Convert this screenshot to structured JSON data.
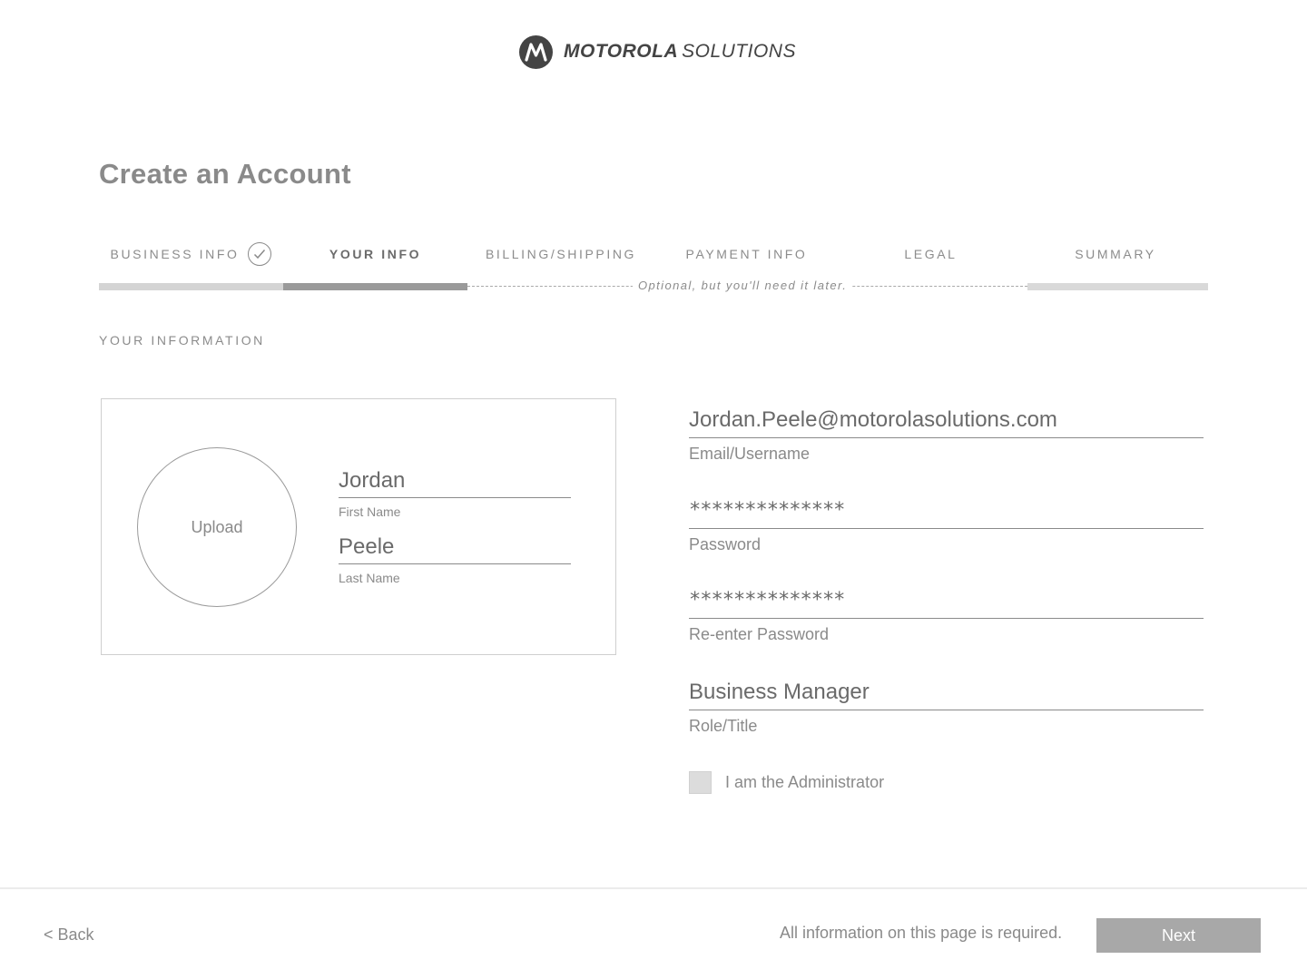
{
  "brand": {
    "name_bold": "MOTOROLA",
    "name_light": "SOLUTIONS"
  },
  "page": {
    "title": "Create an Account",
    "section_label": "YOUR INFORMATION"
  },
  "steps": [
    {
      "label": "BUSINESS INFO",
      "state": "done"
    },
    {
      "label": "YOUR INFO",
      "state": "active"
    },
    {
      "label": "BILLING/SHIPPING",
      "state": "optional"
    },
    {
      "label": "PAYMENT INFO",
      "state": "optional"
    },
    {
      "label": "LEGAL",
      "state": "optional"
    },
    {
      "label": "SUMMARY",
      "state": "pending"
    }
  ],
  "optional_note": "Optional, but you'll need it later.",
  "profile": {
    "upload_label": "Upload",
    "first_name": {
      "value": "Jordan",
      "label": "First Name"
    },
    "last_name": {
      "value": "Peele",
      "label": "Last Name"
    }
  },
  "form": {
    "email": {
      "value": "Jordan.Peele@motorolasolutions.com",
      "label": "Email/Username"
    },
    "password": {
      "value": "**************",
      "label": "Password"
    },
    "password_confirm": {
      "value": "**************",
      "label": "Re-enter Password"
    },
    "role": {
      "value": "Business Manager",
      "label": "Role/Title"
    },
    "admin_checkbox": {
      "label": "I am the Administrator",
      "checked": false
    }
  },
  "footer": {
    "back_label": "< Back",
    "required_note": "All information on this page is required.",
    "next_label": "Next"
  },
  "colors": {
    "active_bar": "#9a9a9a",
    "done_bar": "#d4d4d4",
    "next_button": "#a8a8a8"
  }
}
